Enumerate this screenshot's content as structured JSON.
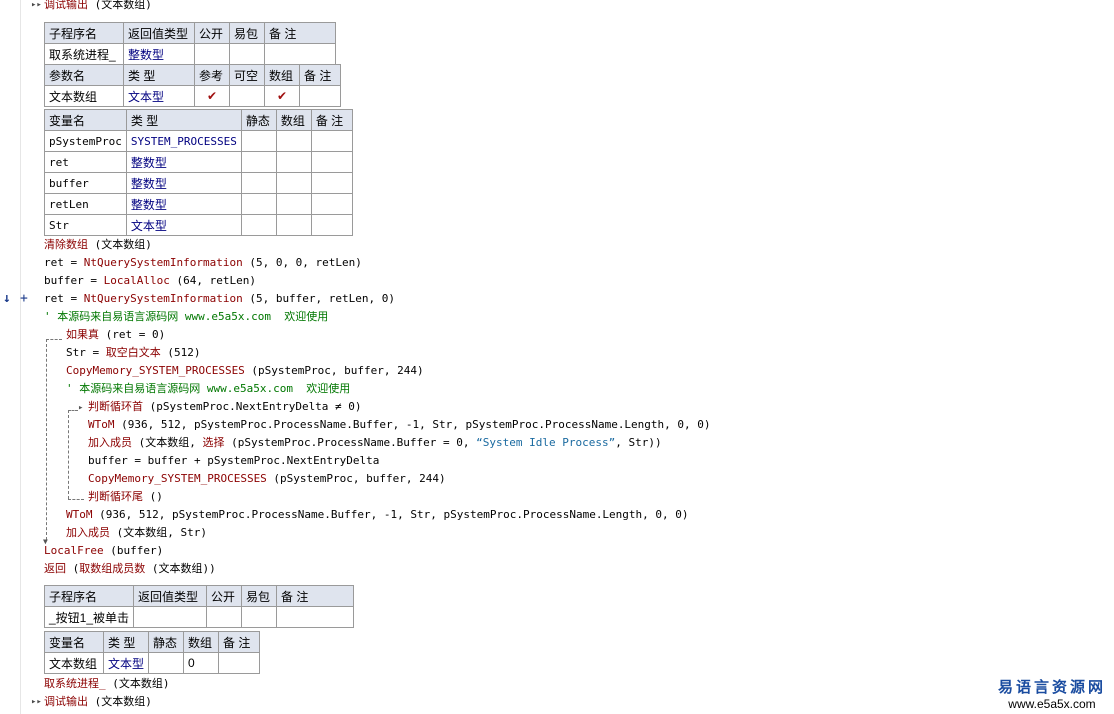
{
  "top_line": {
    "cmd": "调试输出",
    "args": " (文本数组)"
  },
  "sub_table": {
    "headers": [
      "子程序名",
      "返回值类型",
      "公开",
      "易包",
      "备 注"
    ],
    "row": [
      "取系统进程_",
      "整数型",
      "",
      "",
      ""
    ]
  },
  "param_table": {
    "headers": [
      "参数名",
      "类 型",
      "参考",
      "可空",
      "数组",
      "备 注"
    ],
    "row": [
      "文本数组",
      "文本型",
      "✔",
      "",
      "✔",
      ""
    ]
  },
  "var_table": {
    "headers": [
      "变量名",
      "类 型",
      "静态",
      "数组",
      "备 注"
    ],
    "rows": [
      [
        "pSystemProc",
        "SYSTEM_PROCESSES",
        "",
        "",
        ""
      ],
      [
        "ret",
        "整数型",
        "",
        "",
        ""
      ],
      [
        "buffer",
        "整数型",
        "",
        "",
        ""
      ],
      [
        "retLen",
        "整数型",
        "",
        "",
        ""
      ],
      [
        "Str",
        "文本型",
        "",
        "",
        ""
      ]
    ]
  },
  "code": [
    {
      "parts": [
        {
          "c": "cmd",
          "t": "清除数组"
        },
        {
          "c": "plain",
          "t": " (文本数组)"
        }
      ]
    },
    {
      "parts": [
        {
          "c": "plain",
          "t": "ret = "
        },
        {
          "c": "fn",
          "t": "NtQuerySystemInformation"
        },
        {
          "c": "plain",
          "t": " (5, 0, 0, retLen)"
        }
      ]
    },
    {
      "parts": [
        {
          "c": "plain",
          "t": "buffer = "
        },
        {
          "c": "fn",
          "t": "LocalAlloc"
        },
        {
          "c": "plain",
          "t": " (64, retLen)"
        }
      ]
    },
    {
      "parts": [
        {
          "c": "plain",
          "t": "ret = "
        },
        {
          "c": "fn",
          "t": "NtQuerySystemInformation"
        },
        {
          "c": "plain",
          "t": " (5, buffer, retLen, 0)"
        }
      ]
    },
    {
      "parts": [
        {
          "c": "cm",
          "t": "' 本源码来自易语言源码网 www.e5a5x.com  欢迎使用"
        }
      ]
    },
    {
      "parts": [
        {
          "c": "cmd",
          "t": "如果真"
        },
        {
          "c": "plain",
          "t": " (ret = 0)"
        }
      ]
    },
    {
      "parts": [
        {
          "c": "plain",
          "t": "Str = "
        },
        {
          "c": "cmd",
          "t": "取空白文本"
        },
        {
          "c": "plain",
          "t": " (512)"
        }
      ]
    },
    {
      "parts": [
        {
          "c": "fn",
          "t": "CopyMemory_SYSTEM_PROCESSES"
        },
        {
          "c": "plain",
          "t": " (pSystemProc, buffer, 244)"
        }
      ]
    },
    {
      "parts": [
        {
          "c": "cm",
          "t": "' 本源码来自易语言源码网 www.e5a5x.com  欢迎使用"
        }
      ]
    },
    {
      "parts": [
        {
          "c": "cmd",
          "t": "判断循环首"
        },
        {
          "c": "plain",
          "t": " (pSystemProc.NextEntryDelta ≠ 0)"
        }
      ]
    },
    {
      "parts": [
        {
          "c": "fn",
          "t": "WToM"
        },
        {
          "c": "plain",
          "t": " (936, 512, pSystemProc.ProcessName.Buffer, -1, Str, pSystemProc.ProcessName.Length, 0, 0)"
        }
      ]
    },
    {
      "parts": [
        {
          "c": "cmd",
          "t": "加入成员"
        },
        {
          "c": "plain",
          "t": " (文本数组, "
        },
        {
          "c": "cmd",
          "t": "选择"
        },
        {
          "c": "plain",
          "t": " (pSystemProc.ProcessName.Buffer = 0, "
        },
        {
          "c": "str",
          "t": "“System Idle Process”"
        },
        {
          "c": "plain",
          "t": ", Str))"
        }
      ]
    },
    {
      "parts": [
        {
          "c": "plain",
          "t": "buffer = buffer + pSystemProc.NextEntryDelta"
        }
      ]
    },
    {
      "parts": [
        {
          "c": "fn",
          "t": "CopyMemory_SYSTEM_PROCESSES"
        },
        {
          "c": "plain",
          "t": " (pSystemProc, buffer, 244)"
        }
      ]
    },
    {
      "parts": [
        {
          "c": "cmd",
          "t": "判断循环尾"
        },
        {
          "c": "plain",
          "t": " ()"
        }
      ]
    },
    {
      "parts": [
        {
          "c": "fn",
          "t": "WToM"
        },
        {
          "c": "plain",
          "t": " (936, 512, pSystemProc.ProcessName.Buffer, -1, Str, pSystemProc.ProcessName.Length, 0, 0)"
        }
      ]
    },
    {
      "parts": [
        {
          "c": "cmd",
          "t": "加入成员"
        },
        {
          "c": "plain",
          "t": " (文本数组, Str)"
        }
      ]
    },
    {
      "parts": [
        {
          "c": "fn",
          "t": "LocalFree"
        },
        {
          "c": "plain",
          "t": " (buffer)"
        }
      ]
    },
    {
      "parts": [
        {
          "c": "cmd",
          "t": "返回"
        },
        {
          "c": "plain",
          "t": " ("
        },
        {
          "c": "cmd",
          "t": "取数组成员数"
        },
        {
          "c": "plain",
          "t": " (文本数组))"
        }
      ]
    }
  ],
  "sub_table2": {
    "headers": [
      "子程序名",
      "返回值类型",
      "公开",
      "易包",
      "备 注"
    ],
    "row": [
      "_按钮1_被单击",
      "",
      "",
      "",
      ""
    ]
  },
  "var_table2": {
    "headers": [
      "变量名",
      "类 型",
      "静态",
      "数组",
      "备 注"
    ],
    "row": [
      "文本数组",
      "文本型",
      "",
      "0",
      ""
    ]
  },
  "bottom_lines": [
    {
      "parts": [
        {
          "c": "cmd",
          "t": "取系统进程_"
        },
        {
          "c": "plain",
          "t": " (文本数组)"
        }
      ]
    },
    {
      "parts": [
        {
          "c": "cmd",
          "t": "调试输出"
        },
        {
          "c": "plain",
          "t": " (文本数组)"
        }
      ]
    }
  ],
  "watermark": {
    "title": "易语言资源网",
    "url": "www.e5a5x.com"
  }
}
